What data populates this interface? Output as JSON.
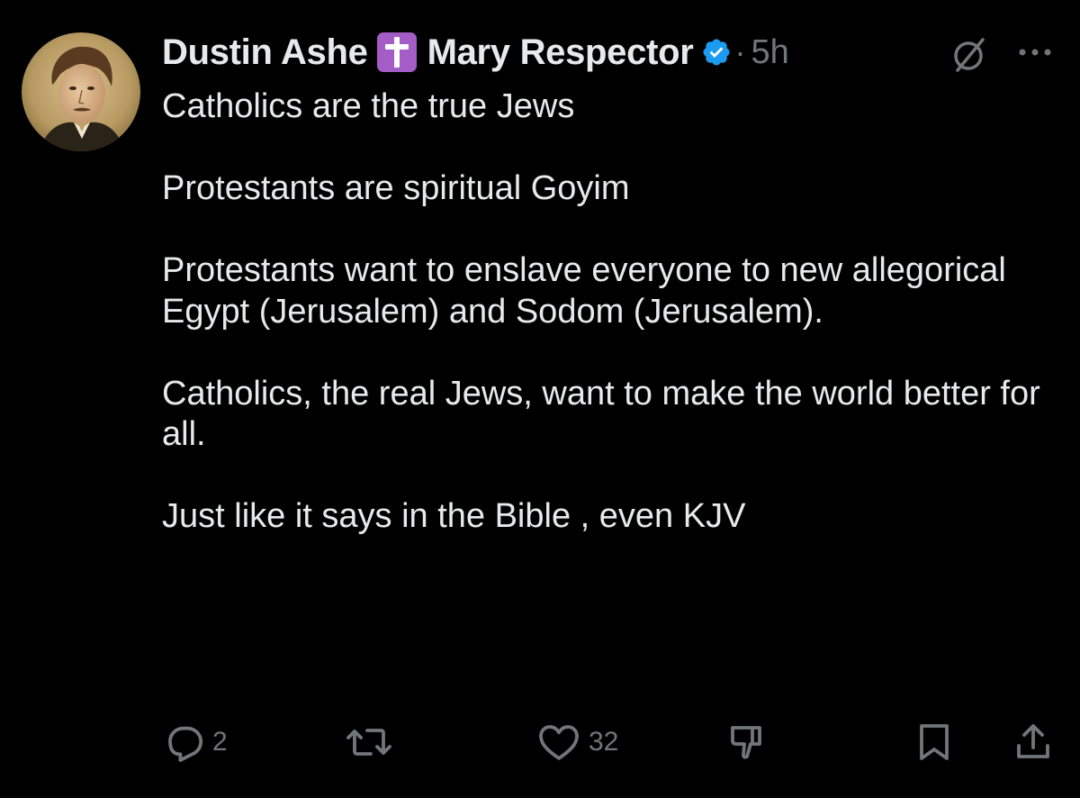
{
  "post": {
    "author": {
      "name_first": "Dustin Ashe",
      "name_badge_icon": "latin-cross-icon",
      "name_second": "Mary Respector",
      "verified_icon": "verified-badge-icon",
      "separator": "·",
      "timestamp": "5h"
    },
    "header_icons": {
      "grok": "grok-icon",
      "more": "more-options-icon"
    },
    "paragraphs": [
      "Catholics are the true Jews",
      "Protestants are spiritual Goyim",
      "Protestants want to enslave everyone to new allegorical Egypt (Jerusalem) and Sodom (Jerusalem).",
      "Catholics, the real Jews, want to make the world better for all.",
      "Just like it says in the Bible , even KJV"
    ],
    "actions": {
      "reply_count": "2",
      "repost_count": "",
      "like_count": "32"
    }
  },
  "colors": {
    "background": "#000000",
    "text": "#e7e9ea",
    "secondary": "#71767b",
    "verified": "#1d9bf0",
    "cross_badge": "#a45cc7"
  }
}
